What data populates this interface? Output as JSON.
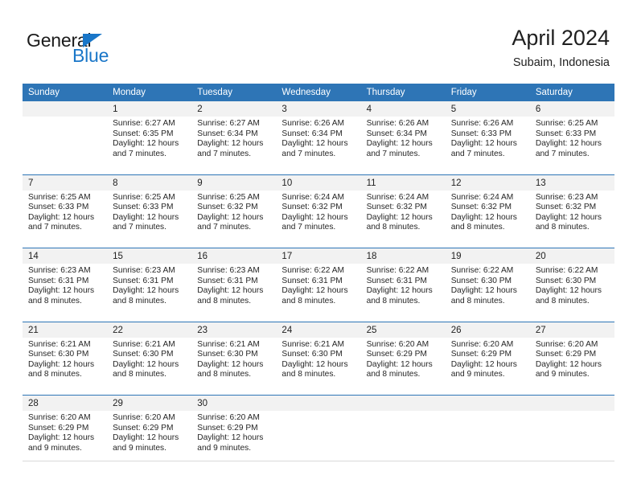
{
  "brand": {
    "name_top": "General",
    "name_bottom": "Blue",
    "triangle_color": "#1976c8"
  },
  "header": {
    "month_title": "April 2024",
    "location": "Subaim, Indonesia",
    "header_bg": "#2e75b6",
    "number_band_bg": "#f2f2f2"
  },
  "weekdays": [
    "Sunday",
    "Monday",
    "Tuesday",
    "Wednesday",
    "Thursday",
    "Friday",
    "Saturday"
  ],
  "weeks": [
    {
      "numbers": [
        "",
        "1",
        "2",
        "3",
        "4",
        "5",
        "6"
      ],
      "cells": [
        {
          "sunrise": "",
          "sunset": "",
          "daylight_1": "",
          "daylight_2": ""
        },
        {
          "sunrise": "Sunrise: 6:27 AM",
          "sunset": "Sunset: 6:35 PM",
          "daylight_1": "Daylight: 12 hours",
          "daylight_2": "and 7 minutes."
        },
        {
          "sunrise": "Sunrise: 6:27 AM",
          "sunset": "Sunset: 6:34 PM",
          "daylight_1": "Daylight: 12 hours",
          "daylight_2": "and 7 minutes."
        },
        {
          "sunrise": "Sunrise: 6:26 AM",
          "sunset": "Sunset: 6:34 PM",
          "daylight_1": "Daylight: 12 hours",
          "daylight_2": "and 7 minutes."
        },
        {
          "sunrise": "Sunrise: 6:26 AM",
          "sunset": "Sunset: 6:34 PM",
          "daylight_1": "Daylight: 12 hours",
          "daylight_2": "and 7 minutes."
        },
        {
          "sunrise": "Sunrise: 6:26 AM",
          "sunset": "Sunset: 6:33 PM",
          "daylight_1": "Daylight: 12 hours",
          "daylight_2": "and 7 minutes."
        },
        {
          "sunrise": "Sunrise: 6:25 AM",
          "sunset": "Sunset: 6:33 PM",
          "daylight_1": "Daylight: 12 hours",
          "daylight_2": "and 7 minutes."
        }
      ]
    },
    {
      "numbers": [
        "7",
        "8",
        "9",
        "10",
        "11",
        "12",
        "13"
      ],
      "cells": [
        {
          "sunrise": "Sunrise: 6:25 AM",
          "sunset": "Sunset: 6:33 PM",
          "daylight_1": "Daylight: 12 hours",
          "daylight_2": "and 7 minutes."
        },
        {
          "sunrise": "Sunrise: 6:25 AM",
          "sunset": "Sunset: 6:33 PM",
          "daylight_1": "Daylight: 12 hours",
          "daylight_2": "and 7 minutes."
        },
        {
          "sunrise": "Sunrise: 6:25 AM",
          "sunset": "Sunset: 6:32 PM",
          "daylight_1": "Daylight: 12 hours",
          "daylight_2": "and 7 minutes."
        },
        {
          "sunrise": "Sunrise: 6:24 AM",
          "sunset": "Sunset: 6:32 PM",
          "daylight_1": "Daylight: 12 hours",
          "daylight_2": "and 7 minutes."
        },
        {
          "sunrise": "Sunrise: 6:24 AM",
          "sunset": "Sunset: 6:32 PM",
          "daylight_1": "Daylight: 12 hours",
          "daylight_2": "and 8 minutes."
        },
        {
          "sunrise": "Sunrise: 6:24 AM",
          "sunset": "Sunset: 6:32 PM",
          "daylight_1": "Daylight: 12 hours",
          "daylight_2": "and 8 minutes."
        },
        {
          "sunrise": "Sunrise: 6:23 AM",
          "sunset": "Sunset: 6:32 PM",
          "daylight_1": "Daylight: 12 hours",
          "daylight_2": "and 8 minutes."
        }
      ]
    },
    {
      "numbers": [
        "14",
        "15",
        "16",
        "17",
        "18",
        "19",
        "20"
      ],
      "cells": [
        {
          "sunrise": "Sunrise: 6:23 AM",
          "sunset": "Sunset: 6:31 PM",
          "daylight_1": "Daylight: 12 hours",
          "daylight_2": "and 8 minutes."
        },
        {
          "sunrise": "Sunrise: 6:23 AM",
          "sunset": "Sunset: 6:31 PM",
          "daylight_1": "Daylight: 12 hours",
          "daylight_2": "and 8 minutes."
        },
        {
          "sunrise": "Sunrise: 6:23 AM",
          "sunset": "Sunset: 6:31 PM",
          "daylight_1": "Daylight: 12 hours",
          "daylight_2": "and 8 minutes."
        },
        {
          "sunrise": "Sunrise: 6:22 AM",
          "sunset": "Sunset: 6:31 PM",
          "daylight_1": "Daylight: 12 hours",
          "daylight_2": "and 8 minutes."
        },
        {
          "sunrise": "Sunrise: 6:22 AM",
          "sunset": "Sunset: 6:31 PM",
          "daylight_1": "Daylight: 12 hours",
          "daylight_2": "and 8 minutes."
        },
        {
          "sunrise": "Sunrise: 6:22 AM",
          "sunset": "Sunset: 6:30 PM",
          "daylight_1": "Daylight: 12 hours",
          "daylight_2": "and 8 minutes."
        },
        {
          "sunrise": "Sunrise: 6:22 AM",
          "sunset": "Sunset: 6:30 PM",
          "daylight_1": "Daylight: 12 hours",
          "daylight_2": "and 8 minutes."
        }
      ]
    },
    {
      "numbers": [
        "21",
        "22",
        "23",
        "24",
        "25",
        "26",
        "27"
      ],
      "cells": [
        {
          "sunrise": "Sunrise: 6:21 AM",
          "sunset": "Sunset: 6:30 PM",
          "daylight_1": "Daylight: 12 hours",
          "daylight_2": "and 8 minutes."
        },
        {
          "sunrise": "Sunrise: 6:21 AM",
          "sunset": "Sunset: 6:30 PM",
          "daylight_1": "Daylight: 12 hours",
          "daylight_2": "and 8 minutes."
        },
        {
          "sunrise": "Sunrise: 6:21 AM",
          "sunset": "Sunset: 6:30 PM",
          "daylight_1": "Daylight: 12 hours",
          "daylight_2": "and 8 minutes."
        },
        {
          "sunrise": "Sunrise: 6:21 AM",
          "sunset": "Sunset: 6:30 PM",
          "daylight_1": "Daylight: 12 hours",
          "daylight_2": "and 8 minutes."
        },
        {
          "sunrise": "Sunrise: 6:20 AM",
          "sunset": "Sunset: 6:29 PM",
          "daylight_1": "Daylight: 12 hours",
          "daylight_2": "and 8 minutes."
        },
        {
          "sunrise": "Sunrise: 6:20 AM",
          "sunset": "Sunset: 6:29 PM",
          "daylight_1": "Daylight: 12 hours",
          "daylight_2": "and 9 minutes."
        },
        {
          "sunrise": "Sunrise: 6:20 AM",
          "sunset": "Sunset: 6:29 PM",
          "daylight_1": "Daylight: 12 hours",
          "daylight_2": "and 9 minutes."
        }
      ]
    },
    {
      "numbers": [
        "28",
        "29",
        "30",
        "",
        "",
        "",
        ""
      ],
      "cells": [
        {
          "sunrise": "Sunrise: 6:20 AM",
          "sunset": "Sunset: 6:29 PM",
          "daylight_1": "Daylight: 12 hours",
          "daylight_2": "and 9 minutes."
        },
        {
          "sunrise": "Sunrise: 6:20 AM",
          "sunset": "Sunset: 6:29 PM",
          "daylight_1": "Daylight: 12 hours",
          "daylight_2": "and 9 minutes."
        },
        {
          "sunrise": "Sunrise: 6:20 AM",
          "sunset": "Sunset: 6:29 PM",
          "daylight_1": "Daylight: 12 hours",
          "daylight_2": "and 9 minutes."
        },
        {
          "sunrise": "",
          "sunset": "",
          "daylight_1": "",
          "daylight_2": ""
        },
        {
          "sunrise": "",
          "sunset": "",
          "daylight_1": "",
          "daylight_2": ""
        },
        {
          "sunrise": "",
          "sunset": "",
          "daylight_1": "",
          "daylight_2": ""
        },
        {
          "sunrise": "",
          "sunset": "",
          "daylight_1": "",
          "daylight_2": ""
        }
      ]
    }
  ]
}
